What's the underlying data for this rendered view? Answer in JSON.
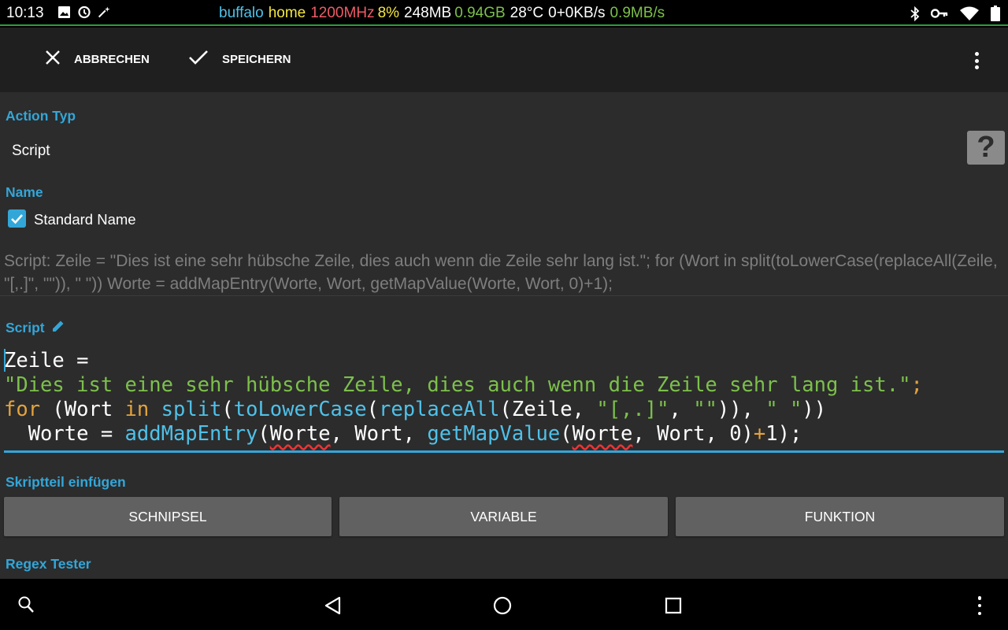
{
  "status_bar": {
    "time": "10:13",
    "info": [
      {
        "text": "buffalo",
        "color": "#4fc1e9"
      },
      {
        "text": "home",
        "color": "#f5e642"
      },
      {
        "text": "1200MHz",
        "color": "#ef5b67"
      },
      {
        "text": "8%",
        "color": "#f5e642"
      },
      {
        "text": "248MB",
        "color": "#ffffff"
      },
      {
        "text": "0.94GB",
        "color": "#7cc04b"
      },
      {
        "text": "28°C",
        "color": "#ffffff"
      },
      {
        "text": "0+0KB/s",
        "color": "#ffffff"
      },
      {
        "text": "0.9MB/s",
        "color": "#7cc04b"
      }
    ]
  },
  "action_bar": {
    "cancel_label": "ABBRECHEN",
    "save_label": "SPEICHERN"
  },
  "action_type": {
    "label": "Action Typ",
    "value": "Script",
    "help": "?"
  },
  "name": {
    "label": "Name",
    "checkbox_label": "Standard Name",
    "checked": true,
    "description": "Script: Zeile = \"Dies ist eine sehr hübsche Zeile, dies auch wenn die Zeile sehr lang ist.\"; for (Wort in split(toLowerCase(replaceAll(Zeile, \"[,.]\", \"\")), \" \")) Worte = addMapEntry(Worte, Wort, getMapValue(Worte, Wort, 0)+1);"
  },
  "script": {
    "label": "Script",
    "lines": [
      [
        {
          "t": "Zeile = ",
          "c": ""
        }
      ],
      [
        {
          "t": "\"Dies ist eine sehr hübsche Zeile, dies auch wenn die Zeile sehr lang ist.\"",
          "c": "str"
        },
        {
          "t": ";",
          "c": "kw"
        }
      ],
      [
        {
          "t": "for",
          "c": "kw"
        },
        {
          "t": " (Wort ",
          "c": ""
        },
        {
          "t": "in",
          "c": "kw"
        },
        {
          "t": " ",
          "c": ""
        },
        {
          "t": "split",
          "c": "fn"
        },
        {
          "t": "(",
          "c": ""
        },
        {
          "t": "toLowerCase",
          "c": "fn"
        },
        {
          "t": "(",
          "c": ""
        },
        {
          "t": "replaceAll",
          "c": "fn"
        },
        {
          "t": "(Zeile, ",
          "c": ""
        },
        {
          "t": "\"[,.]\"",
          "c": "str"
        },
        {
          "t": ", ",
          "c": ""
        },
        {
          "t": "\"\"",
          "c": "str"
        },
        {
          "t": ")), ",
          "c": ""
        },
        {
          "t": "\" \"",
          "c": "str"
        },
        {
          "t": "))",
          "c": ""
        }
      ],
      [
        {
          "t": "  Worte = ",
          "c": ""
        },
        {
          "t": "addMapEntry",
          "c": "fn"
        },
        {
          "t": "(",
          "c": ""
        },
        {
          "t": "Worte",
          "c": "sq"
        },
        {
          "t": ", Wort, ",
          "c": ""
        },
        {
          "t": "getMapValue",
          "c": "fn"
        },
        {
          "t": "(",
          "c": ""
        },
        {
          "t": "Worte",
          "c": "sq"
        },
        {
          "t": ", Wort, 0)",
          "c": ""
        },
        {
          "t": "+",
          "c": "kw"
        },
        {
          "t": "1);",
          "c": ""
        }
      ]
    ]
  },
  "insert": {
    "label": "Skriptteil einfügen",
    "snippet_label": "SCHNIPSEL",
    "variable_label": "VARIABLE",
    "function_label": "FUNKTION"
  },
  "regex": {
    "label": "Regex Tester"
  },
  "colors": {
    "accent": "#33a6d8",
    "background": "#2c2c2c",
    "actionbar": "#1f1f1f",
    "button": "#616161"
  },
  "icons": [
    "image-icon",
    "alarm-icon",
    "sparkle-icon",
    "bluetooth-icon",
    "key-icon",
    "wifi-icon",
    "battery-icon",
    "close-icon",
    "check-icon",
    "overflow-menu-icon",
    "help-icon",
    "pencil-icon",
    "search-icon",
    "back-icon",
    "home-icon",
    "recents-icon"
  ]
}
